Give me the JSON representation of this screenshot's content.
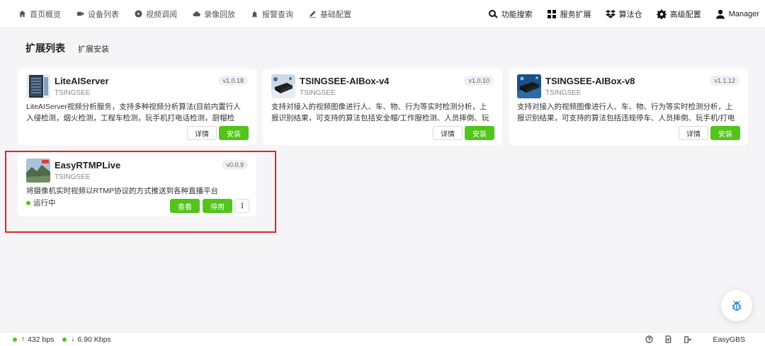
{
  "nav": {
    "left": [
      {
        "label": "首页概览",
        "icon": "home-icon"
      },
      {
        "label": "设备列表",
        "icon": "camera-icon"
      },
      {
        "label": "视频调阅",
        "icon": "play-icon"
      },
      {
        "label": "录像回放",
        "icon": "cloud-icon"
      },
      {
        "label": "报警查询",
        "icon": "alarm-icon"
      },
      {
        "label": "基础配置",
        "icon": "pen-icon"
      }
    ],
    "right": [
      {
        "label": "功能搜索",
        "icon": "search-icon"
      },
      {
        "label": "服务扩展",
        "icon": "grid-icon"
      },
      {
        "label": "算法仓",
        "icon": "dropbox-icon"
      },
      {
        "label": "高级配置",
        "icon": "gear-icon"
      },
      {
        "label": "Manager",
        "icon": "user-icon"
      }
    ]
  },
  "page": {
    "title": "扩展列表",
    "tab": "扩展安装"
  },
  "cards": [
    {
      "name": "LiteAIServer",
      "vendor": "TSINGSEE",
      "version": "v1.0.18",
      "desc": "LiteAIServer视频分析服务，支持多种视频分析算法(目前内置行人入侵检测，烟火检测，工程车检测，玩手机打电话检测，厨帽检测，车辆检…",
      "btn_detail": "详情",
      "btn_install": "安装"
    },
    {
      "name": "TSINGSEE-AIBox-v4",
      "vendor": "TSINGSEE",
      "version": "v1.0.10",
      "desc": "支持对接入的视频图像进行人、车、物、行为等实时检测分析，上报识别结果，可支持的算法包括安全帽/工作服检测、人员摔倒、玩手机/打…",
      "btn_detail": "详情",
      "btn_install": "安装"
    },
    {
      "name": "TSINGSEE-AIBox-v8",
      "vendor": "TSINGSEE",
      "version": "v1.1.12",
      "desc": "支持对接入的视频图像进行人、车、物、行为等实时检测分析，上报识别结果，可支持的算法包括违规停车、人员摔倒、玩手机/打电话检测…",
      "btn_detail": "详情",
      "btn_install": "安装"
    },
    {
      "name": "EasyRTMPLive",
      "vendor": "TSINGSEE",
      "version": "v0.0.9",
      "desc": "将摄像机实时视频以RTMP协议的方式推送到各种直播平台",
      "status": "运行中",
      "btn_view": "查看",
      "btn_stop": "停用",
      "btn_more": "⋮"
    }
  ],
  "footer": {
    "up_rate": "432 bps",
    "down_rate": "6.90 Kbps",
    "brand": "EasyGBS"
  },
  "colors": {
    "accent": "#52c41a",
    "highlight": "#e1251b"
  }
}
